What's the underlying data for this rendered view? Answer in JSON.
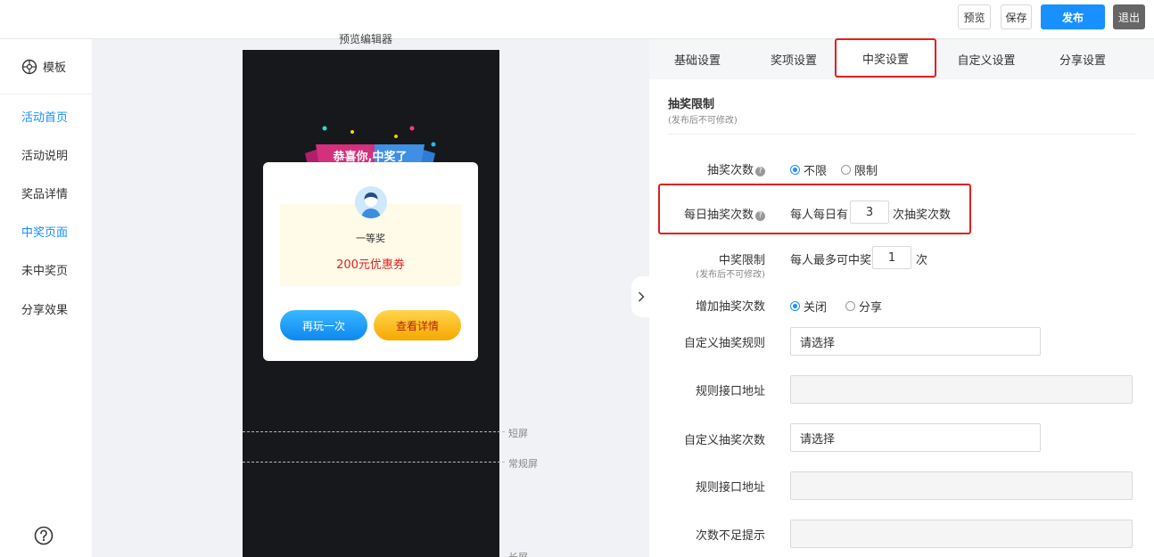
{
  "topbar": {
    "preview": "预览",
    "save": "保存",
    "publish": "发布",
    "exit": "退出"
  },
  "nav": {
    "header": "模板",
    "items": [
      {
        "label": "活动首页",
        "active": true
      },
      {
        "label": "活动说明",
        "active": false
      },
      {
        "label": "奖品详情",
        "active": false
      },
      {
        "label": "中奖页面",
        "active": true
      },
      {
        "label": "未中奖页",
        "active": false
      },
      {
        "label": "分享效果",
        "active": false
      }
    ]
  },
  "canvas": {
    "label": "预览编辑器",
    "banner": "恭喜你,中奖了",
    "prize_level": "一等奖",
    "prize_name": "200元优惠券",
    "again_btn": "再玩一次",
    "detail_btn": "查看详情",
    "guides": [
      "短屏",
      "常规屏",
      "长屏"
    ]
  },
  "tabs": [
    "基础设置",
    "奖项设置",
    "中奖设置",
    "自定义设置",
    "分享设置"
  ],
  "active_tab": "中奖设置",
  "settings": {
    "section_title": "抽奖限制",
    "section_sub": "(发布后不可修改)",
    "draw_count_label": "抽奖次数",
    "draw_count_options": [
      "不限",
      "限制"
    ],
    "draw_count_selected": "不限",
    "daily_label": "每日抽奖次数",
    "daily_prefix": "每人每日有",
    "daily_value": "3",
    "daily_suffix": "次抽奖次数",
    "win_limit_label": "中奖限制",
    "win_limit_sub": "(发布后不可修改)",
    "win_limit_prefix": "每人最多可中奖",
    "win_limit_value": "1",
    "win_limit_suffix": "次",
    "add_draw_label": "增加抽奖次数",
    "add_draw_options": [
      "关闭",
      "分享"
    ],
    "add_draw_selected": "关闭",
    "custom_rule_label": "自定义抽奖规则",
    "custom_rule_value": "请选择",
    "rule_api_label": "规则接口地址",
    "custom_count_label": "自定义抽奖次数",
    "custom_count_value": "请选择",
    "rule_api_label_2": "规则接口地址",
    "insufficient_label": "次数不足提示"
  },
  "colors": {
    "primary": "#1890ff",
    "highlight": "#e02020",
    "phone_bg": "#17181b"
  }
}
